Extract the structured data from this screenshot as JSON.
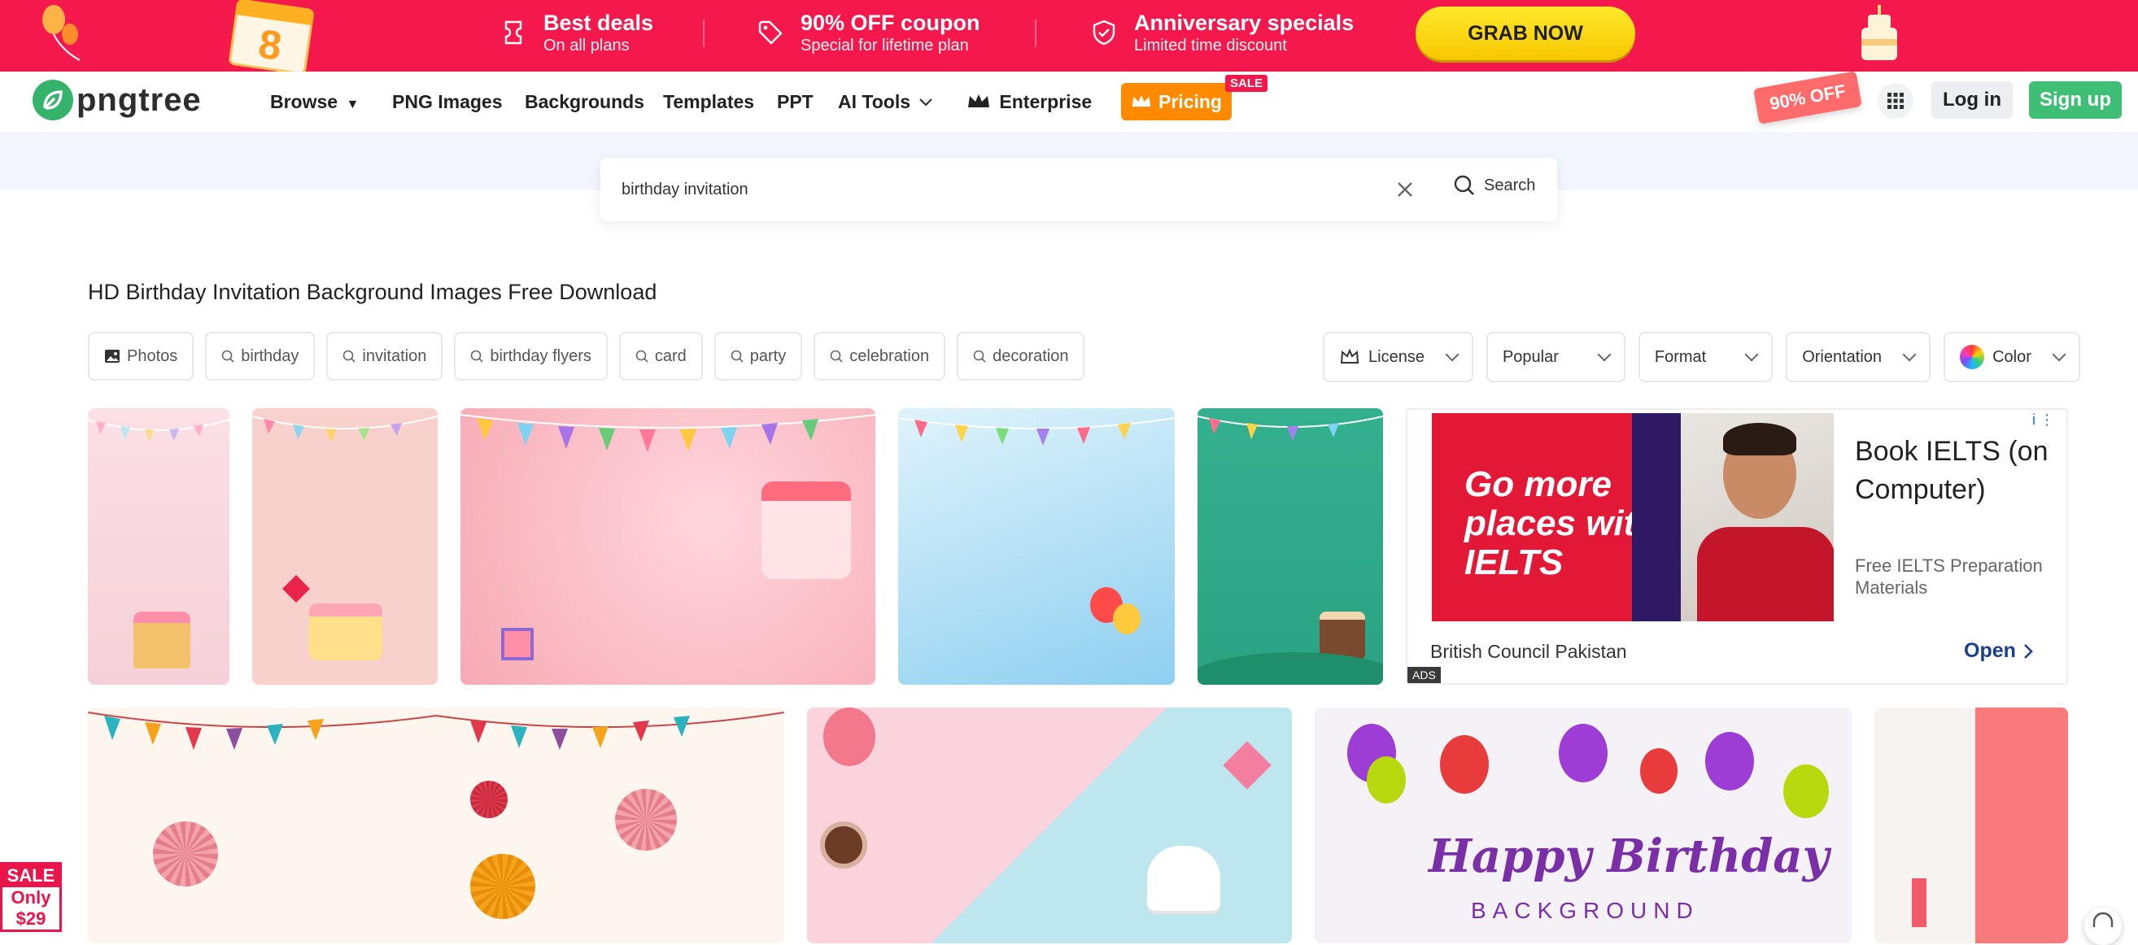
{
  "promo": {
    "deal1_title": "Best deals",
    "deal1_sub": "On all plans",
    "deal2_title": "90% OFF coupon",
    "deal2_sub": "Special for lifetime plan",
    "deal3_title": "Anniversary specials",
    "deal3_sub": "Limited time discount",
    "grab_label": "GRAB NOW",
    "calendar_digit": "8",
    "colors": {
      "background": "#f5184c",
      "button": "#ffd600"
    }
  },
  "nav": {
    "logo_text": "pngtree",
    "items": [
      "Browse",
      "PNG Images",
      "Backgrounds",
      "Templates",
      "PPT",
      "AI Tools",
      "Enterprise"
    ],
    "pricing_label": "Pricing",
    "sale_tag": "SALE",
    "discount_tag": "90% OFF",
    "login_label": "Log in",
    "signup_label": "Sign up"
  },
  "search": {
    "value": "birthday invitation",
    "placeholder": "",
    "button_label": "Search"
  },
  "page": {
    "title": "HD Birthday Invitation Background Images Free Download"
  },
  "chips": [
    "Photos",
    "birthday",
    "invitation",
    "birthday flyers",
    "card",
    "party",
    "celebration",
    "decoration"
  ],
  "filters": [
    "License",
    "Popular",
    "Format",
    "Orientation",
    "Color"
  ],
  "ad": {
    "image_text": "Go more places with IELTS",
    "headline": "Book IELTS (on Computer)",
    "subtext": "Free IELTS Preparation Materials",
    "advertiser": "British Council Pakistan",
    "cta": "Open",
    "badge": "ADS",
    "info_icon": "i"
  },
  "cards": {
    "happy_birthday_text": "Happy Birthday",
    "background_text": "BACKGROUND"
  },
  "sale_badge": {
    "line1": "SALE",
    "line2": "Only",
    "line3": "$29"
  }
}
